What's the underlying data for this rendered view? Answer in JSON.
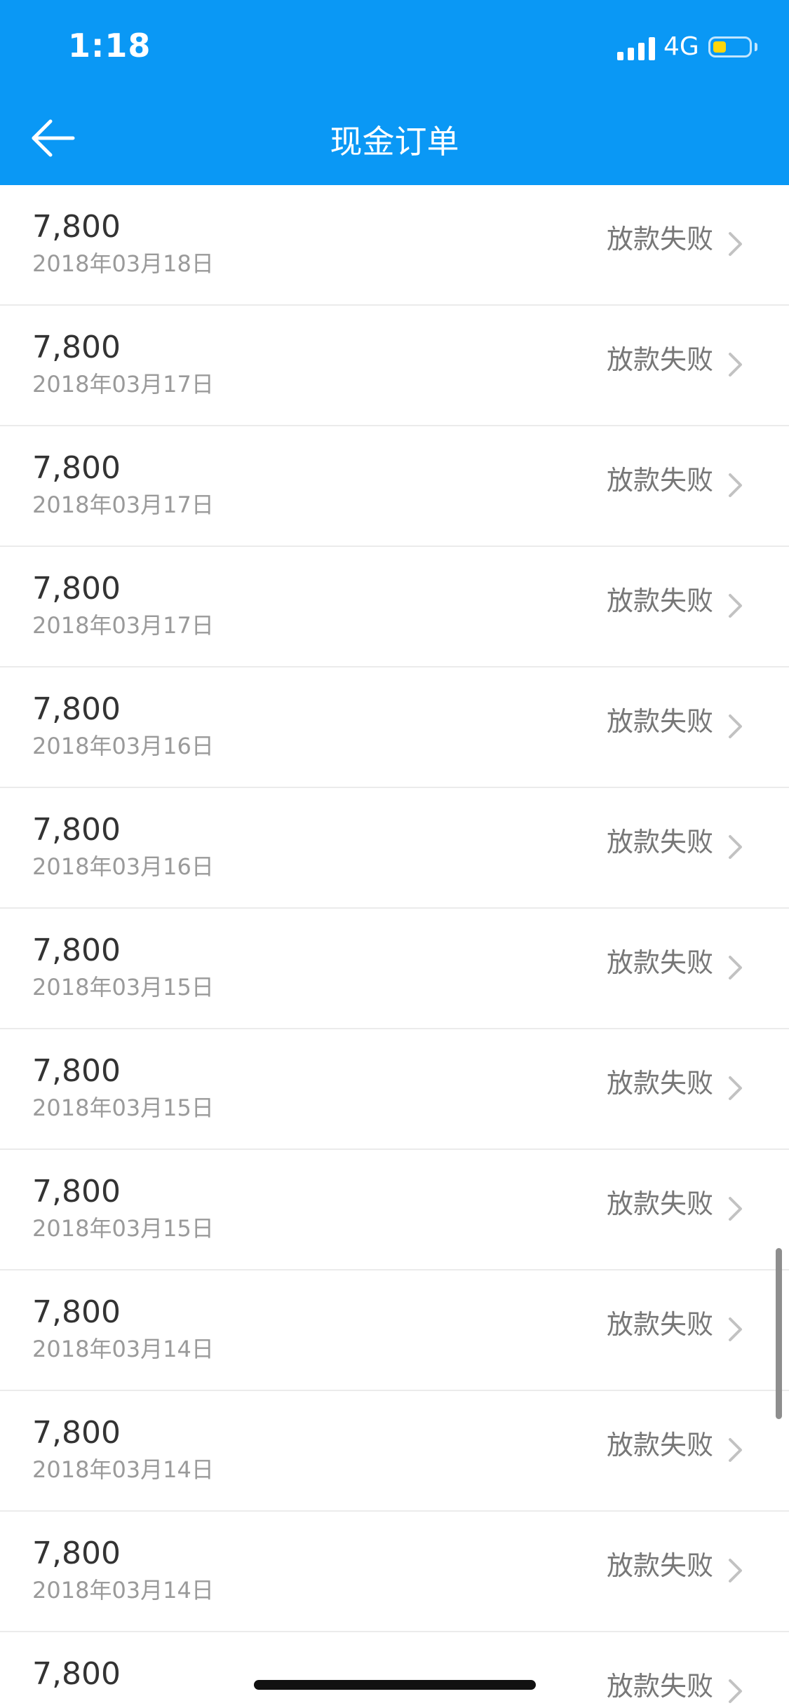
{
  "status_bar": {
    "time": "1:18",
    "network": "4G",
    "battery_level": 0.35,
    "battery_color": "#ffd60a"
  },
  "header": {
    "title": "现金订单",
    "back_icon": "arrow-left-icon",
    "background_color": "#0a98f5"
  },
  "orders": [
    {
      "amount": "7,800",
      "date": "2018年03月18日",
      "status": "放款失败"
    },
    {
      "amount": "7,800",
      "date": "2018年03月17日",
      "status": "放款失败"
    },
    {
      "amount": "7,800",
      "date": "2018年03月17日",
      "status": "放款失败"
    },
    {
      "amount": "7,800",
      "date": "2018年03月17日",
      "status": "放款失败"
    },
    {
      "amount": "7,800",
      "date": "2018年03月16日",
      "status": "放款失败"
    },
    {
      "amount": "7,800",
      "date": "2018年03月16日",
      "status": "放款失败"
    },
    {
      "amount": "7,800",
      "date": "2018年03月15日",
      "status": "放款失败"
    },
    {
      "amount": "7,800",
      "date": "2018年03月15日",
      "status": "放款失败"
    },
    {
      "amount": "7,800",
      "date": "2018年03月15日",
      "status": "放款失败"
    },
    {
      "amount": "7,800",
      "date": "2018年03月14日",
      "status": "放款失败"
    },
    {
      "amount": "7,800",
      "date": "2018年03月14日",
      "status": "放款失败"
    },
    {
      "amount": "7,800",
      "date": "2018年03月14日",
      "status": "放款失败"
    },
    {
      "amount": "7,800",
      "date": "",
      "status": "放款失败"
    }
  ]
}
